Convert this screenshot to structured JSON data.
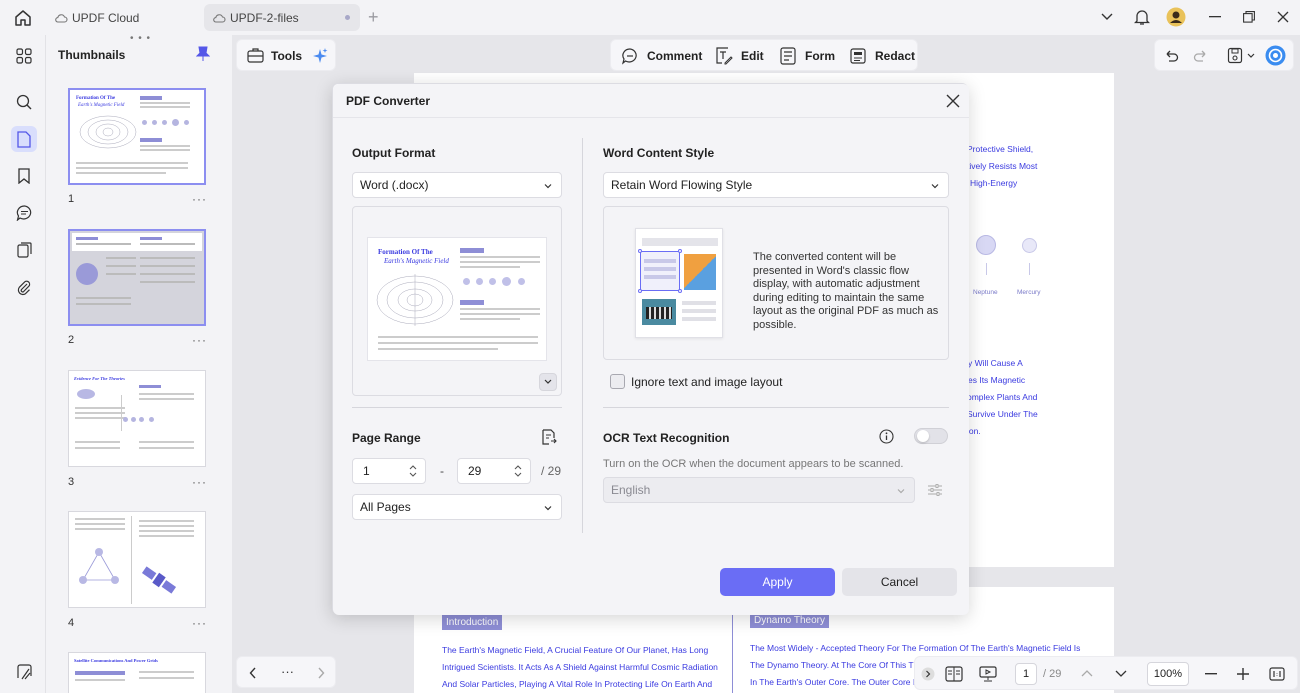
{
  "tabs": [
    {
      "label": "UPDF Cloud"
    },
    {
      "label": "UPDF-2-files"
    }
  ],
  "sidebar": {
    "title": "Thumbnails",
    "pages": [
      "1",
      "2",
      "3",
      "4"
    ]
  },
  "toolbar": {
    "tools_label": "Tools",
    "modes": [
      {
        "label": "Comment"
      },
      {
        "label": "Edit"
      },
      {
        "label": "Form"
      },
      {
        "label": "Redact"
      }
    ]
  },
  "document": {
    "right_lines": [
      "Protective Shield,",
      "tively Resists Most",
      "High-Energy"
    ],
    "planet_labels": [
      "Neptune",
      "Mercury"
    ],
    "right_lines2": [
      "y Will Cause A",
      "es Its Magnetic",
      "omplex Plants And",
      "Survive Under The",
      "ion."
    ],
    "page2_left_heading": "Introduction",
    "page2_left_lines": [
      "The Earth's Magnetic Field, A Crucial Feature Of Our Planet, Has Long",
      "Intrigued Scientists. It Acts As A Shield Against Harmful Cosmic Radiation",
      "And Solar Particles, Playing A Vital Role In Protecting Life On Earth And"
    ],
    "page2_right_heading": "Dynamo Theory",
    "page2_right_lines": [
      "The Most Widely - Accepted Theory For The Formation Of The Earth's Magnetic Field Is",
      "The Dynamo Theory. At The Core Of This The",
      "In The Earth's Outer Core. The Outer Core Is"
    ]
  },
  "thumbnail_texts": {
    "p1_title": "Formation Of The",
    "p1_subtitle": "Earth's Magnetic Field",
    "p3_title": "Evidence For The Theories",
    "p5_title": "Satellite Communications And Power Grids"
  },
  "statusbar": {
    "current_page": "1",
    "total_pages": "/ 29",
    "zoom": "100%",
    "more": "···"
  },
  "dialog": {
    "title": "PDF Converter",
    "output_format_label": "Output Format",
    "output_format_value": "Word (.docx)",
    "word_style_label": "Word Content Style",
    "word_style_value": "Retain Word Flowing Style",
    "style_description": "The converted content will be presented in Word's classic flow display, with automatic adjustment during editing to maintain the same layout as the original PDF as much as possible.",
    "ignore_layout_label": "Ignore text and image layout",
    "page_range_label": "Page Range",
    "range_from": "1",
    "range_dash": "-",
    "range_to": "29",
    "range_total": "/ 29",
    "pages_select": "All Pages",
    "ocr_label": "OCR Text Recognition",
    "ocr_description": "Turn on the OCR when the document appears to be scanned.",
    "ocr_language": "English",
    "ocr_enabled": false,
    "apply_label": "Apply",
    "cancel_label": "Cancel",
    "preview_title": "Formation Of The",
    "preview_subtitle": "Earth's Magnetic Field"
  },
  "colors": {
    "accent": "#6a6df5",
    "doc_text": "#3a3ae0"
  }
}
